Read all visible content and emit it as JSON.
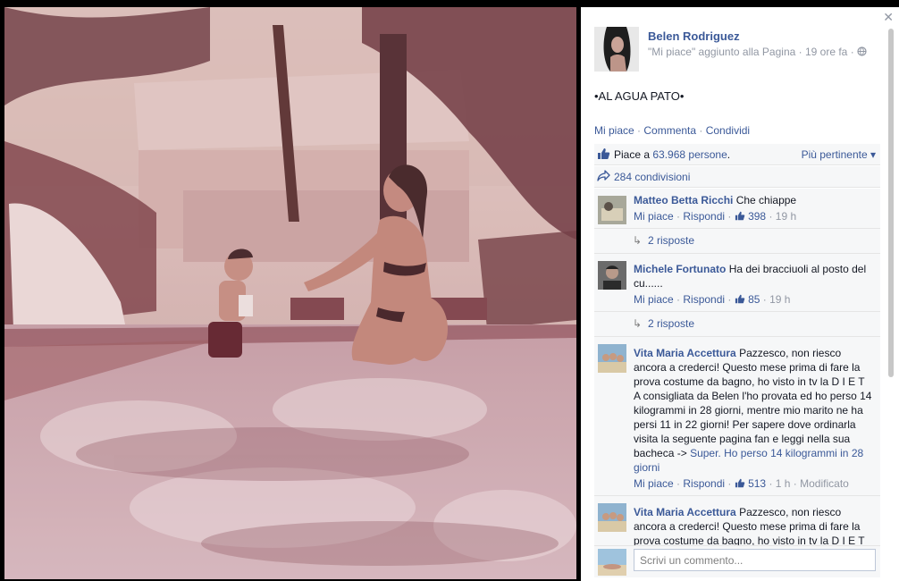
{
  "post": {
    "author": "Belen Rodriguez",
    "activity": "\"Mi piace\" aggiunto alla Pagina",
    "time": "19 ore fa",
    "caption": "•AL AGUA PATO•"
  },
  "actions": {
    "like": "Mi piace",
    "comment": "Commenta",
    "share": "Condividi"
  },
  "likes": {
    "prefix": "Piace a",
    "count": "63.968 persone",
    "suffix": ".",
    "sort": "Più pertinente ▾"
  },
  "shares": "284 condivisioni",
  "comments": [
    {
      "author": "Matteo Betta Ricchi",
      "text": "Che chiappe",
      "like": "Mi piace",
      "reply": "Rispondi",
      "likes": "398",
      "time": "19 h",
      "replies": "2 risposte"
    },
    {
      "author": "Michele Fortunato",
      "text": "Ha dei bracciuoli al posto del cu......",
      "like": "Mi piace",
      "reply": "Rispondi",
      "likes": "85",
      "time": "19 h",
      "replies": "2 risposte"
    },
    {
      "author": "Vita Maria Accettura",
      "text": "Pazzesco, non riesco ancora a crederci! Questo mese prima di fare la prova costume da bagno, ho visto in tv la D I E T A consigliata da Belen l'ho provata ed ho perso 14 kilogrammi in 28 giorni, mentre mio marito ne ha persi 11 in 22 giorni! Per sapere dove ordinarla visita la seguente pagina fan e leggi nella sua bacheca ->",
      "link": "Super. Ho perso 14 kilogrammi in 28 giorni",
      "like": "Mi piace",
      "reply": "Rispondi",
      "likes": "513",
      "time": "1 h",
      "edited": "Modificato"
    },
    {
      "author": "Vita Maria Accettura",
      "text": "Pazzesco, non riesco ancora a crederci! Questo mese prima di fare la prova costume da bagno, ho visto in tv la D I E T"
    }
  ],
  "composer": {
    "placeholder": "Scrivi un commento..."
  },
  "icons": {
    "close": "close-icon",
    "globe": "globe-icon",
    "thumb": "thumbs-up-icon",
    "share": "share-arrow-icon",
    "reply": "reply-arrow-icon"
  },
  "colors": {
    "link": "#3b5998",
    "meta": "#9197a3",
    "panel_bg": "#f6f7f8"
  }
}
